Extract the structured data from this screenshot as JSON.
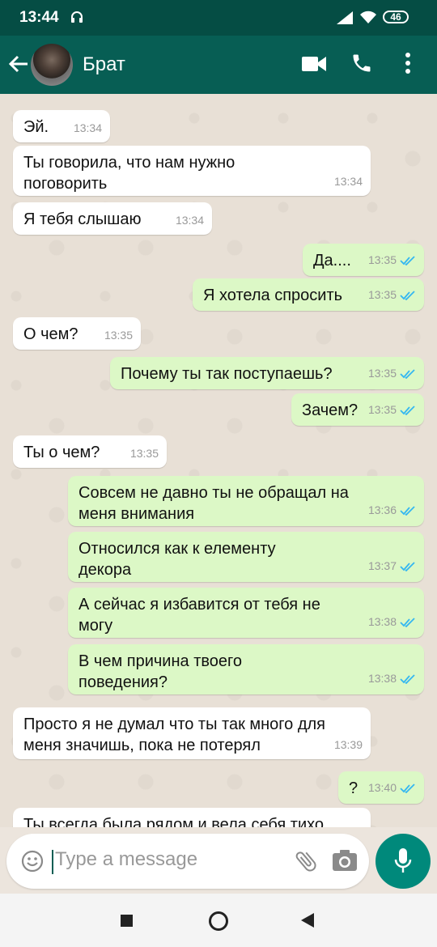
{
  "status_bar": {
    "time": "13:44",
    "battery": "46"
  },
  "header": {
    "contact_name": "Брат"
  },
  "messages": [
    {
      "dir": "in",
      "text": "Эй.",
      "time": "13:34"
    },
    {
      "dir": "in",
      "text": "Ты говорила, что нам нужно\nпоговорить",
      "time": "13:34"
    },
    {
      "dir": "in",
      "text": "Я тебя слышаю",
      "time": "13:34"
    },
    {
      "dir": "out",
      "text": "Да....",
      "time": "13:35"
    },
    {
      "dir": "out",
      "text": "Я хотела спросить",
      "time": "13:35"
    },
    {
      "dir": "in",
      "text": "О чем?",
      "time": "13:35"
    },
    {
      "dir": "out",
      "text": "Почему ты так поступаешь?",
      "time": "13:35"
    },
    {
      "dir": "out",
      "text": "Зачем?",
      "time": "13:35"
    },
    {
      "dir": "in",
      "text": "Ты о чем?",
      "time": "13:35"
    },
    {
      "dir": "out",
      "text": "Совсем не давно ты не обращал на\nменя внимания",
      "time": "13:36"
    },
    {
      "dir": "out",
      "text": "Относился как к елементу\nдекора",
      "time": "13:37"
    },
    {
      "dir": "out",
      "text": "А сейчас я избавится от тебя не\nмогу",
      "time": "13:38"
    },
    {
      "dir": "out",
      "text": "В чем причина твоего\nповедения?",
      "time": "13:38"
    },
    {
      "dir": "in",
      "text": "Просто я не думал что ты так много для\nменя значишь, пока не потерял",
      "time": "13:39"
    },
    {
      "dir": "out",
      "text": "?",
      "time": "13:40"
    },
    {
      "dir": "in",
      "text": "Ты всегда была рядом и вела себя тихо",
      "time": ""
    }
  ],
  "composer": {
    "placeholder": "Type a message"
  },
  "colors": {
    "header": "#075e54",
    "status_bar": "#054d44",
    "outgoing_bubble": "#dcf8c6",
    "read_tick": "#34b7f1",
    "mic_button": "#00897b"
  },
  "icons": [
    "back-arrow-icon",
    "video-call-icon",
    "phone-icon",
    "more-vertical-icon",
    "emoji-icon",
    "attach-icon",
    "camera-icon",
    "mic-icon",
    "headphones-icon",
    "signal-icon",
    "wifi-icon"
  ]
}
